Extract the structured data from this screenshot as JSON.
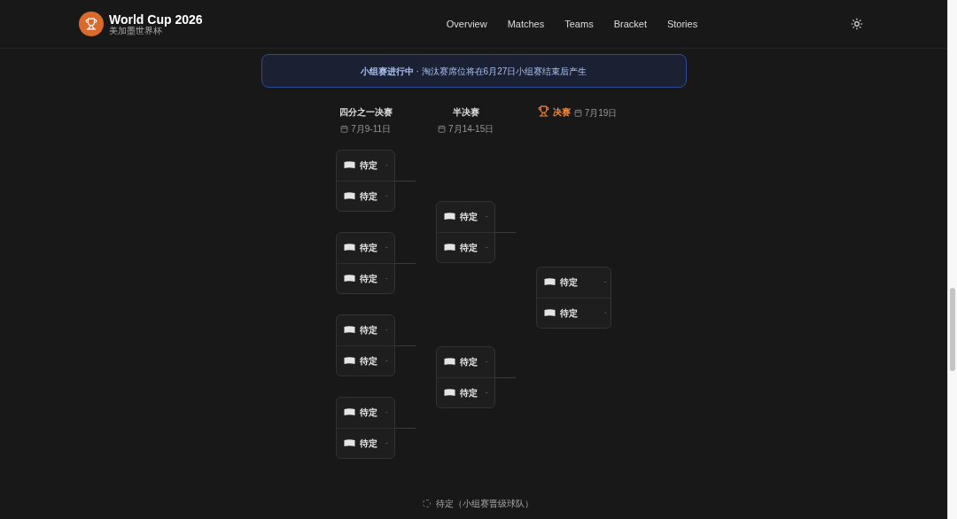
{
  "brand": {
    "title": "World Cup 2026",
    "subtitle": "美加墨世界杯"
  },
  "nav": [
    {
      "label": "Overview",
      "selected": false
    },
    {
      "label": "Matches",
      "selected": false
    },
    {
      "label": "Teams",
      "selected": false
    },
    {
      "label": "Bracket",
      "selected": false
    },
    {
      "label": "Stories",
      "selected": false
    }
  ],
  "notice": "**小组赛进行中** · 淘汰赛席位将在6月27日小组赛结束后产生",
  "rounds": [
    {
      "kind": "quarter",
      "title": "四分之一决赛",
      "date": "7月9-11日",
      "matches": [
        {
          "teams": [
            {
              "name": "待定",
              "score": "-"
            },
            {
              "name": "待定",
              "score": "-"
            }
          ]
        },
        {
          "teams": [
            {
              "name": "待定",
              "score": "-"
            },
            {
              "name": "待定",
              "score": "-"
            }
          ]
        },
        {
          "teams": [
            {
              "name": "待定",
              "score": "-"
            },
            {
              "name": "待定",
              "score": "-"
            }
          ]
        },
        {
          "teams": [
            {
              "name": "待定",
              "score": "-"
            },
            {
              "name": "待定",
              "score": "-"
            }
          ]
        }
      ]
    },
    {
      "kind": "semi",
      "title": "半决赛",
      "date": "7月14-15日",
      "matches": [
        {
          "teams": [
            {
              "name": "待定",
              "score": "-"
            },
            {
              "name": "待定",
              "score": "-"
            }
          ]
        },
        {
          "teams": [
            {
              "name": "待定",
              "score": "-"
            },
            {
              "name": "待定",
              "score": "-"
            }
          ]
        }
      ]
    },
    {
      "kind": "final",
      "title": "决赛",
      "date": "7月19日",
      "matches": [
        {
          "teams": [
            {
              "name": "待定",
              "score": "-"
            },
            {
              "name": "待定",
              "score": "-"
            }
          ]
        }
      ]
    }
  ],
  "legend": "待定（小组赛晋级球队）"
}
